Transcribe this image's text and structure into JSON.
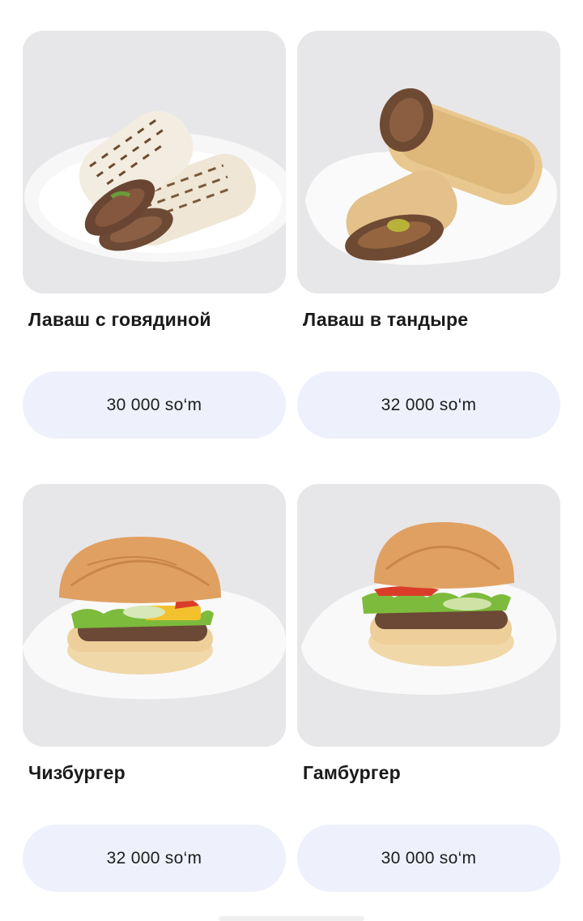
{
  "products": [
    {
      "name": "Лаваш с говядиной",
      "price": "30 000 so‘m",
      "image_icon": "beef-lavash-photo"
    },
    {
      "name": "Лаваш в тандыре",
      "price": "32 000 so‘m",
      "image_icon": "tandoor-lavash-photo"
    },
    {
      "name": "Чизбургер",
      "price": "32 000 so‘m",
      "image_icon": "cheeseburger-photo"
    },
    {
      "name": "Гамбургер",
      "price": "30 000 so‘m",
      "image_icon": "hamburger-photo"
    }
  ],
  "colors": {
    "photo_bg": "#e6e6e8",
    "price_button_bg": "#eef1fb",
    "text": "#1a1a1a"
  }
}
